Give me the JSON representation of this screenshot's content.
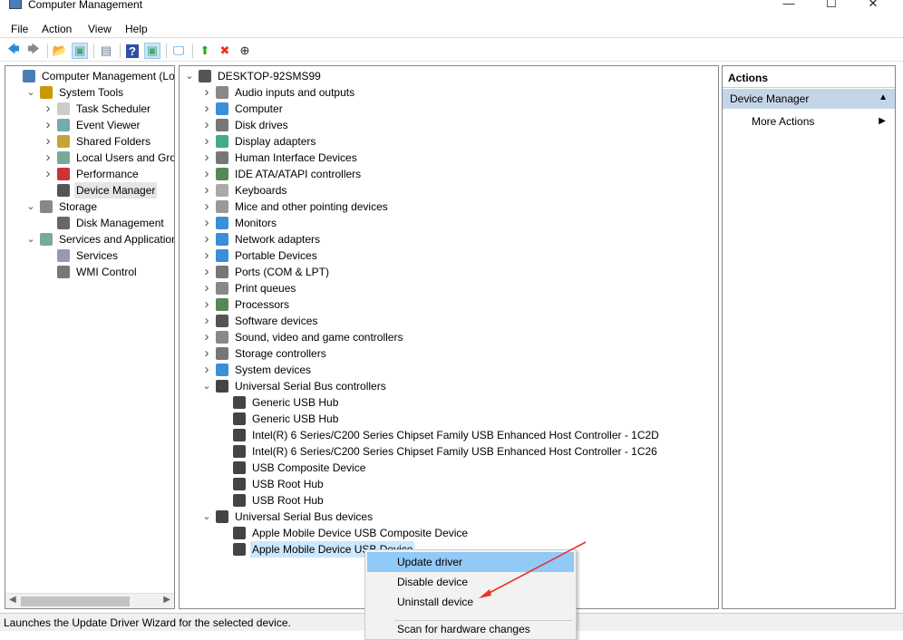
{
  "window": {
    "title": "Computer Management",
    "min": "—",
    "max": "☐",
    "close": "✕"
  },
  "menu": [
    "File",
    "Action",
    "View",
    "Help"
  ],
  "toolbar": [
    {
      "icon": "back-icon",
      "g": "🡄",
      "c": "#2b8ad8"
    },
    {
      "icon": "forward-icon",
      "g": "🡆",
      "c": "#888"
    },
    {
      "sep": true
    },
    {
      "icon": "up-folder-icon",
      "g": "📂",
      "c": "#c9a23a"
    },
    {
      "icon": "show-hide-tree-icon",
      "g": "▣",
      "c": "#4a7",
      "on": true
    },
    {
      "sep": true
    },
    {
      "icon": "properties-icon",
      "g": "▤",
      "c": "#678"
    },
    {
      "sep": true
    },
    {
      "icon": "help-icon",
      "g": "?",
      "c": "#fff",
      "bg": "#2d4fa8"
    },
    {
      "icon": "show-action-pane-icon",
      "g": "▣",
      "c": "#4a7",
      "on": true
    },
    {
      "sep": true
    },
    {
      "icon": "scan-hardware-icon",
      "g": "🖵",
      "c": "#2b8ad8"
    },
    {
      "sep": true
    },
    {
      "icon": "update-driver-icon",
      "g": "⬆",
      "c": "#2a2"
    },
    {
      "icon": "uninstall-icon",
      "g": "✖",
      "c": "#e31"
    },
    {
      "icon": "disable-device-icon",
      "g": "⊕",
      "c": "#222"
    }
  ],
  "left_tree": [
    {
      "d": 0,
      "t": "Computer Management (Local",
      "c": "",
      "i": "#4a7fb5"
    },
    {
      "d": 1,
      "t": "System Tools",
      "c": "v",
      "i": "#c90"
    },
    {
      "d": 2,
      "t": "Task Scheduler",
      "c": ">",
      "i": "#ccc"
    },
    {
      "d": 2,
      "t": "Event Viewer",
      "c": ">",
      "i": "#7aa"
    },
    {
      "d": 2,
      "t": "Shared Folders",
      "c": ">",
      "i": "#c9a23a"
    },
    {
      "d": 2,
      "t": "Local Users and Groups",
      "c": ">",
      "i": "#7a9"
    },
    {
      "d": 2,
      "t": "Performance",
      "c": ">",
      "i": "#c33"
    },
    {
      "d": 2,
      "t": "Device Manager",
      "c": "",
      "i": "#555",
      "sel": true
    },
    {
      "d": 1,
      "t": "Storage",
      "c": "v",
      "i": "#888"
    },
    {
      "d": 2,
      "t": "Disk Management",
      "c": "",
      "i": "#666"
    },
    {
      "d": 1,
      "t": "Services and Applications",
      "c": "v",
      "i": "#7a9"
    },
    {
      "d": 2,
      "t": "Services",
      "c": "",
      "i": "#99a"
    },
    {
      "d": 2,
      "t": "WMI Control",
      "c": "",
      "i": "#777"
    }
  ],
  "device_tree": [
    {
      "d": 0,
      "t": "DESKTOP-92SMS99",
      "c": "v",
      "i": "#555"
    },
    {
      "d": 1,
      "t": "Audio inputs and outputs",
      "c": ">",
      "i": "#888"
    },
    {
      "d": 1,
      "t": "Computer",
      "c": ">",
      "i": "#3a8fd8"
    },
    {
      "d": 1,
      "t": "Disk drives",
      "c": ">",
      "i": "#777"
    },
    {
      "d": 1,
      "t": "Display adapters",
      "c": ">",
      "i": "#4a8"
    },
    {
      "d": 1,
      "t": "Human Interface Devices",
      "c": ">",
      "i": "#777"
    },
    {
      "d": 1,
      "t": "IDE ATA/ATAPI controllers",
      "c": ">",
      "i": "#585"
    },
    {
      "d": 1,
      "t": "Keyboards",
      "c": ">",
      "i": "#aaa"
    },
    {
      "d": 1,
      "t": "Mice and other pointing devices",
      "c": ">",
      "i": "#999"
    },
    {
      "d": 1,
      "t": "Monitors",
      "c": ">",
      "i": "#3a8fd8"
    },
    {
      "d": 1,
      "t": "Network adapters",
      "c": ">",
      "i": "#3a8fd8"
    },
    {
      "d": 1,
      "t": "Portable Devices",
      "c": ">",
      "i": "#3a8fd8"
    },
    {
      "d": 1,
      "t": "Ports (COM & LPT)",
      "c": ">",
      "i": "#777"
    },
    {
      "d": 1,
      "t": "Print queues",
      "c": ">",
      "i": "#888"
    },
    {
      "d": 1,
      "t": "Processors",
      "c": ">",
      "i": "#585"
    },
    {
      "d": 1,
      "t": "Software devices",
      "c": ">",
      "i": "#555"
    },
    {
      "d": 1,
      "t": "Sound, video and game controllers",
      "c": ">",
      "i": "#888"
    },
    {
      "d": 1,
      "t": "Storage controllers",
      "c": ">",
      "i": "#777"
    },
    {
      "d": 1,
      "t": "System devices",
      "c": ">",
      "i": "#3a8fd8"
    },
    {
      "d": 1,
      "t": "Universal Serial Bus controllers",
      "c": "v",
      "i": "#444"
    },
    {
      "d": 2,
      "t": "Generic USB Hub",
      "c": "",
      "i": "#444"
    },
    {
      "d": 2,
      "t": "Generic USB Hub",
      "c": "",
      "i": "#444"
    },
    {
      "d": 2,
      "t": "Intel(R) 6 Series/C200 Series Chipset Family USB Enhanced Host Controller - 1C2D",
      "c": "",
      "i": "#444"
    },
    {
      "d": 2,
      "t": "Intel(R) 6 Series/C200 Series Chipset Family USB Enhanced Host Controller - 1C26",
      "c": "",
      "i": "#444"
    },
    {
      "d": 2,
      "t": "USB Composite Device",
      "c": "",
      "i": "#444"
    },
    {
      "d": 2,
      "t": "USB Root Hub",
      "c": "",
      "i": "#444"
    },
    {
      "d": 2,
      "t": "USB Root Hub",
      "c": "",
      "i": "#444"
    },
    {
      "d": 1,
      "t": "Universal Serial Bus devices",
      "c": "v",
      "i": "#444"
    },
    {
      "d": 2,
      "t": "Apple Mobile Device USB Composite Device",
      "c": "",
      "i": "#444"
    },
    {
      "d": 2,
      "t": "Apple Mobile Device USB Device",
      "c": "",
      "i": "#444",
      "sel": true
    }
  ],
  "actions": {
    "header": "Actions",
    "section": "Device Manager",
    "more": "More Actions"
  },
  "context_menu": [
    "Update driver",
    "Disable device",
    "Uninstall device",
    "Scan for hardware changes"
  ],
  "status": "Launches the Update Driver Wizard for the selected device.",
  "colors": {
    "highlight": "#91c9f7",
    "annotation_arrow": "#e8322a"
  }
}
